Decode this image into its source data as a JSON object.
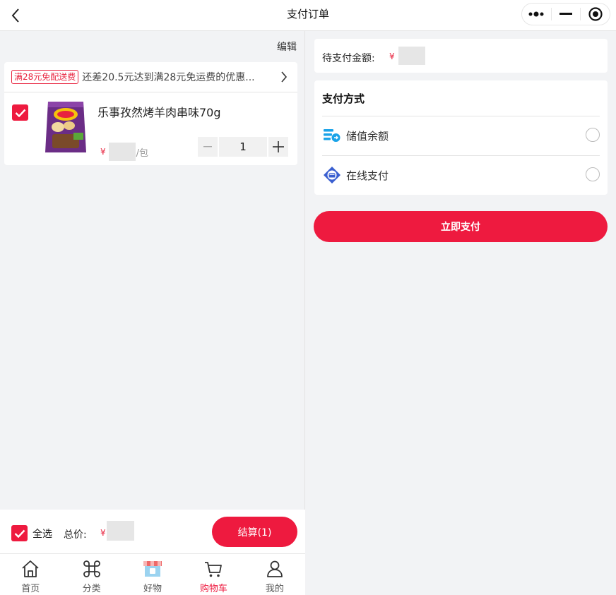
{
  "header": {
    "title": "支付订单"
  },
  "cart": {
    "edit_label": "编辑",
    "promo": {
      "tag": "满28元免配送费",
      "text": "还差20.5元达到满28元免运费的优惠..."
    },
    "item": {
      "name": "乐事孜然烤羊肉串味70g",
      "currency": "¥",
      "unit": "/包",
      "quantity": "1"
    },
    "select_all_label": "全选",
    "total_label": "总价:",
    "total_currency": "¥",
    "checkout_label": "结算(1)"
  },
  "tabs": [
    {
      "label": "首页",
      "icon": "home-icon"
    },
    {
      "label": "分类",
      "icon": "command-icon"
    },
    {
      "label": "好物",
      "icon": "shop-icon"
    },
    {
      "label": "购物车",
      "icon": "cart-icon",
      "active": true
    },
    {
      "label": "我的",
      "icon": "user-icon"
    }
  ],
  "payment": {
    "amount_label": "待支付金额:",
    "amount_currency": "¥",
    "method_title": "支付方式",
    "options": [
      {
        "label": "储值余额",
        "icon": "balance-icon"
      },
      {
        "label": "在线支付",
        "icon": "online-pay-icon"
      }
    ],
    "pay_button_label": "立即支付"
  },
  "colors": {
    "accent": "#ee1a3f",
    "background": "#f2f3f5"
  }
}
